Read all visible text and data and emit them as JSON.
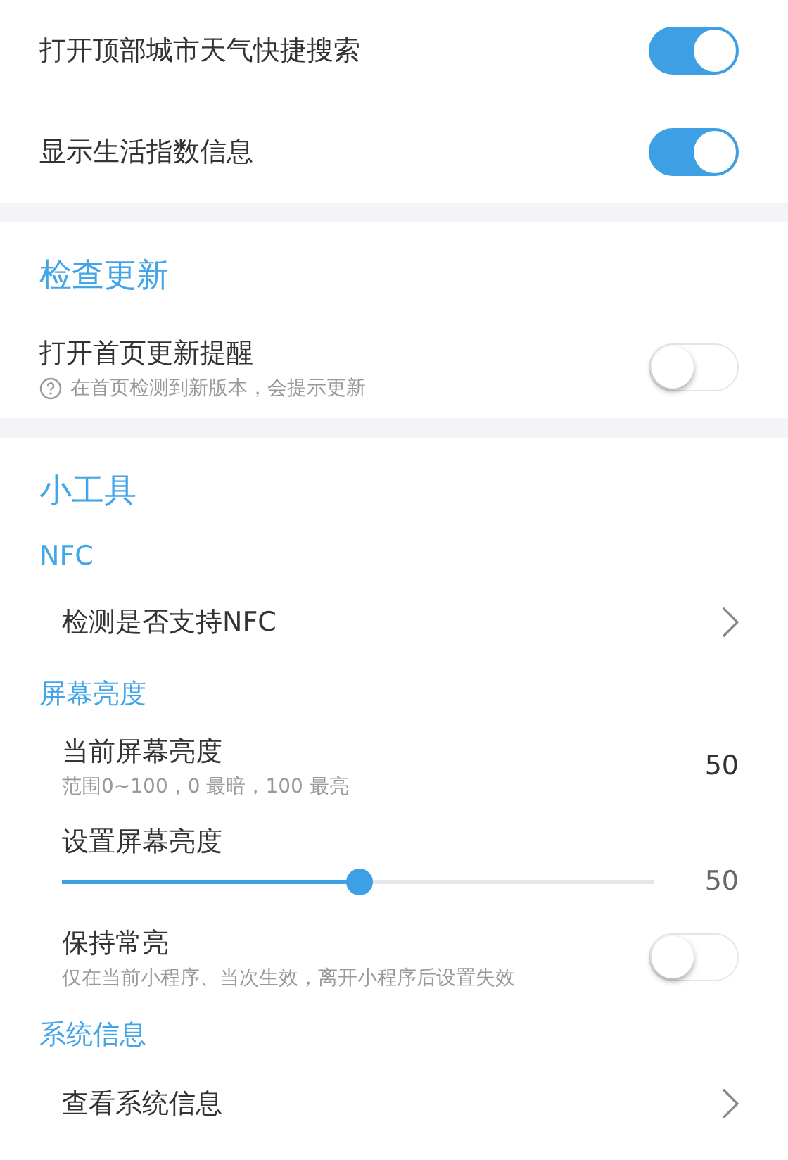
{
  "sections": [
    {
      "items": [
        {
          "kind": "toggle",
          "label": "打开顶部城市天气快捷搜索",
          "on": true
        },
        {
          "kind": "toggle",
          "label": "显示生活指数信息",
          "on": true
        }
      ]
    },
    {
      "title": "检查更新",
      "items": [
        {
          "kind": "toggle",
          "label": "打开首页更新提醒",
          "hint": "在首页检测到新版本，会提示更新",
          "help": true,
          "on": false
        }
      ]
    },
    {
      "title": "小工具",
      "groups": [
        {
          "title": "NFC",
          "items": [
            {
              "kind": "link",
              "label": "检测是否支持NFC"
            }
          ]
        },
        {
          "title": "屏幕亮度",
          "items": [
            {
              "kind": "value",
              "label": "当前屏幕亮度",
              "hint": "范围0~100，0 最暗，100 最亮",
              "value": "50"
            },
            {
              "kind": "slider",
              "label": "设置屏幕亮度",
              "level": 0.5,
              "value": "50"
            },
            {
              "kind": "toggle",
              "label": "保持常亮",
              "hint": "仅在当前小程序、当次生效，离开小程序后设置失效",
              "on": false
            }
          ]
        },
        {
          "title": "系统信息",
          "items": [
            {
              "kind": "link",
              "label": "查看系统信息"
            }
          ]
        }
      ]
    }
  ]
}
